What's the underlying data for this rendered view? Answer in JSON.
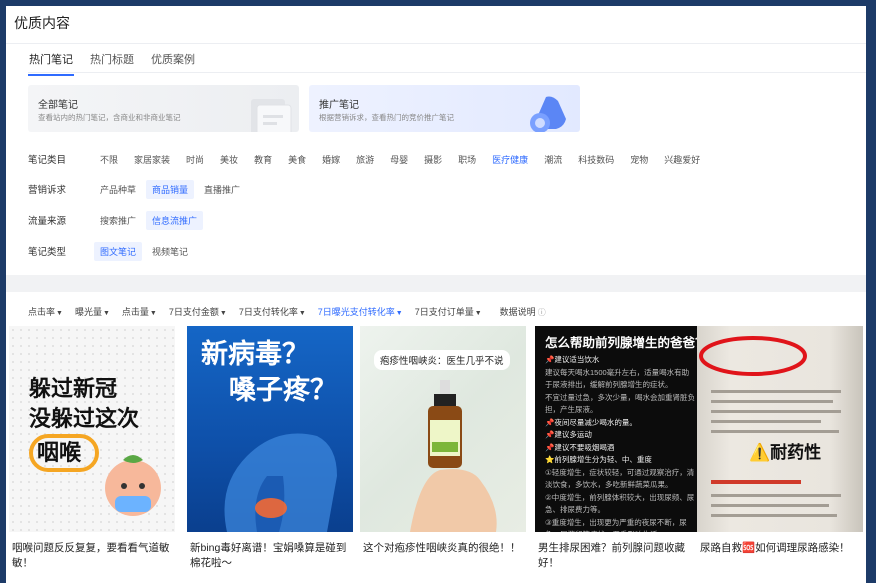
{
  "page": {
    "title": "优质内容"
  },
  "tabs": [
    {
      "label": "热门笔记",
      "active": true
    },
    {
      "label": "热门标题",
      "active": false
    },
    {
      "label": "优质案例",
      "active": false
    }
  ],
  "cards": [
    {
      "title": "全部笔记",
      "desc": "查看站内的热门笔记，含商业和非商业笔记"
    },
    {
      "title": "推广笔记",
      "desc": "根据营销诉求，查看热门的竞价推广笔记"
    }
  ],
  "filters": {
    "category": {
      "label": "笔记类目",
      "options": [
        "不限",
        "家居家装",
        "时尚",
        "美妆",
        "教育",
        "美食",
        "婚嫁",
        "旅游",
        "母婴",
        "摄影",
        "职场",
        "医疗健康",
        "潮流",
        "科技数码",
        "宠物",
        "兴趣爱好"
      ],
      "highlighted": "医疗健康"
    },
    "marketing": {
      "label": "营销诉求",
      "options": [
        "产品种草",
        "商品销量",
        "直播推广"
      ],
      "selected": "商品销量"
    },
    "traffic": {
      "label": "流量来源",
      "options": [
        "搜索推广",
        "信息流推广"
      ],
      "selected": "信息流推广"
    },
    "note_type": {
      "label": "笔记类型",
      "options": [
        "图文笔记",
        "视频笔记"
      ],
      "selected": "图文笔记"
    }
  },
  "sort": {
    "options": [
      "点击率",
      "曝光量",
      "点击量",
      "7日支付金额",
      "7日支付转化率",
      "7日曝光支付转化率",
      "7日支付订单量"
    ],
    "selected": "7日曝光支付转化率",
    "info": "数据说明"
  },
  "notes": [
    {
      "title": "咽喉问题反反复复，要看看气道敏敏！",
      "image_text": [
        "躲过新冠",
        "没躲过这次",
        "咽喉"
      ]
    },
    {
      "title": "新bing毒好离谱！宝娟嗓算是碰到棉花啦～",
      "image_text": [
        "新病毒？",
        "嗓子疼？"
      ]
    },
    {
      "title": "这个对疱疹性咽峡炎真的很绝！！",
      "image_text": [
        "疱疹性咽峡炎：医生几乎不说"
      ]
    },
    {
      "title": "男生排尿困难？前列腺问题收藏好！",
      "image_text": [
        "怎么帮助前列腺增生的爸爸？",
        "📌建议适当饮水",
        "📌夜间尽量减少喝水的量。",
        "📌建议多运动",
        "📌建议不要吸烟喝酒",
        "⭐前列腺增生分为轻、中、重度"
      ]
    },
    {
      "title": "尿路自救🆘如何调理尿路感染！",
      "image_text": [
        "⚠️耐药性"
      ]
    }
  ],
  "colors": {
    "accent": "#2f6bff",
    "frame": "#1d3b68"
  }
}
